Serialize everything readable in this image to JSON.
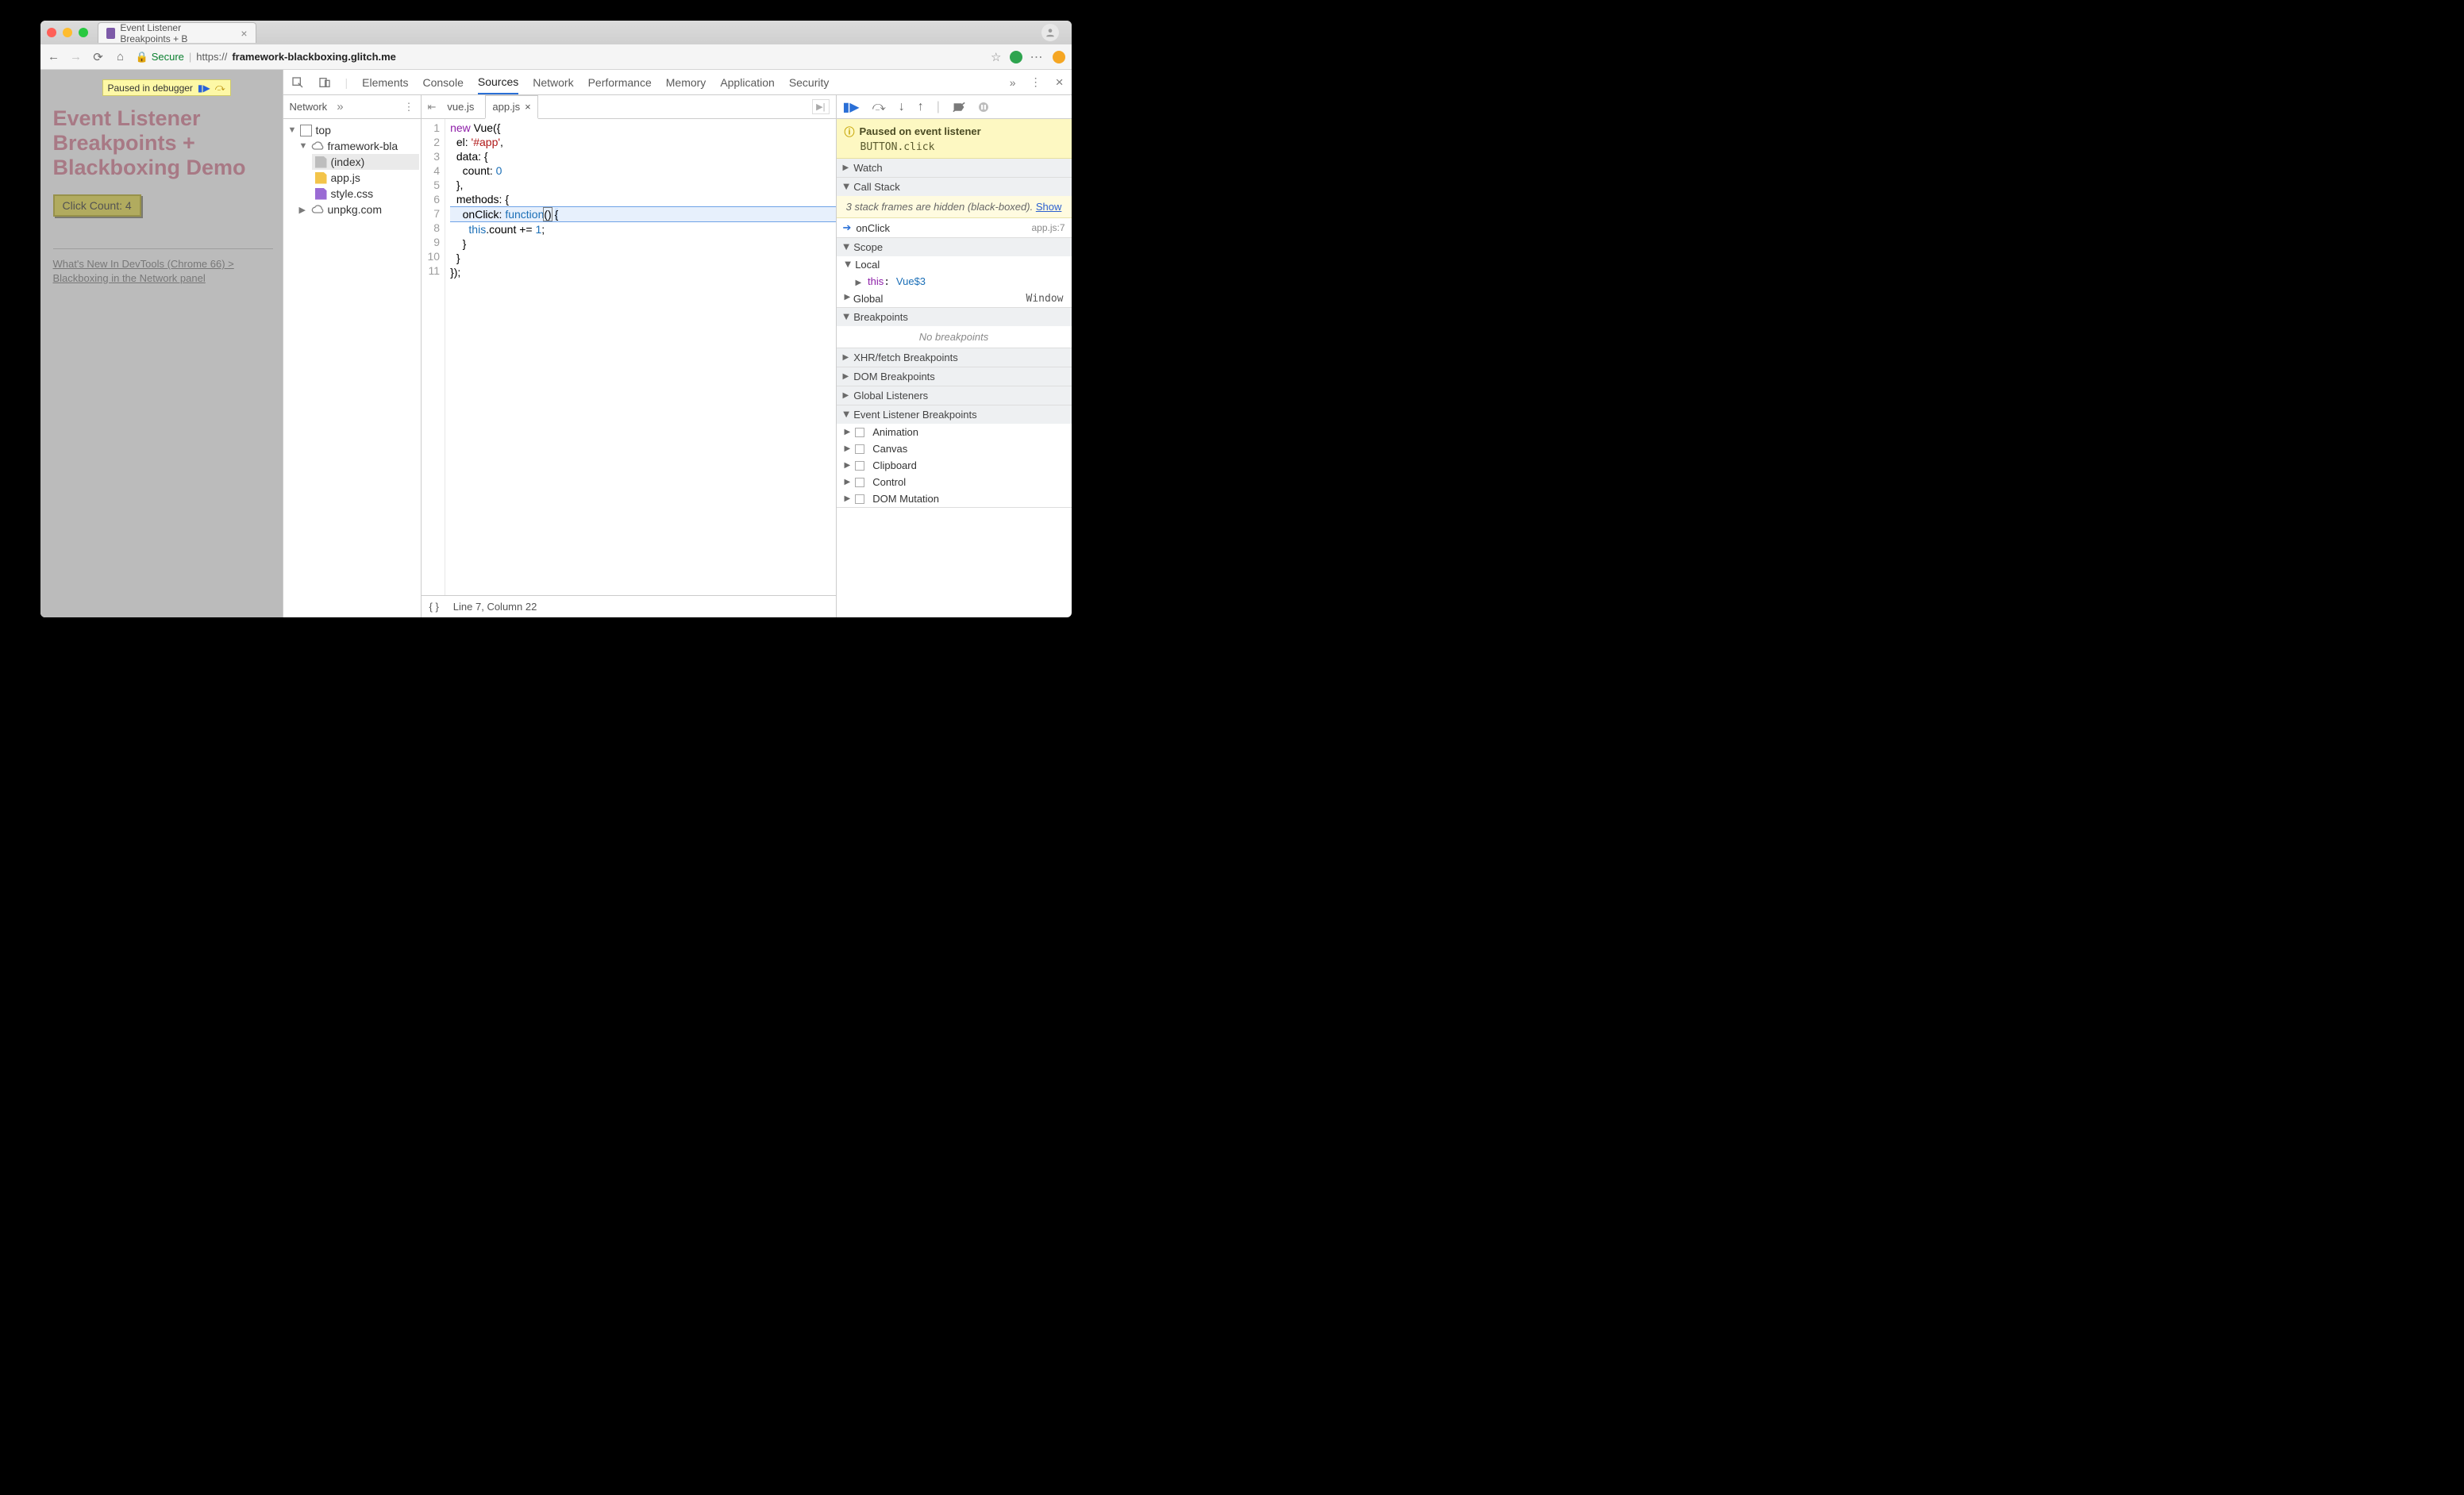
{
  "chrome": {
    "tab_title": "Event Listener Breakpoints + B",
    "secure_label": "Secure",
    "url_prefix": "https://",
    "url_host": "framework-blackboxing.glitch.me"
  },
  "page": {
    "pause_badge": "Paused in debugger",
    "heading": "Event Listener Breakpoints + Blackboxing Demo",
    "button_label": "Click Count: 4",
    "link_text": "What's New In DevTools (Chrome 66) > Blackboxing in the Network panel"
  },
  "devtools": {
    "tabs": [
      "Elements",
      "Console",
      "Sources",
      "Network",
      "Performance",
      "Memory",
      "Application",
      "Security"
    ],
    "active_tab": "Sources",
    "navigator": {
      "subtab": "Network",
      "tree": {
        "top": "top",
        "host": "framework-bla",
        "files": [
          "(index)",
          "app.js",
          "style.css"
        ],
        "external": "unpkg.com"
      }
    },
    "editor": {
      "open_tabs": [
        "vue.js",
        "app.js"
      ],
      "active_tab": "app.js",
      "lines": [
        "new Vue({",
        "  el: '#app',",
        "  data: {",
        "    count: 0",
        "  },",
        "  methods: {",
        "    onClick: function() {",
        "      this.count += 1;",
        "    }",
        "  }",
        "});"
      ],
      "status": "Line 7, Column 22"
    },
    "paused": {
      "title": "Paused on event listener",
      "detail": "BUTTON.click"
    },
    "sections": {
      "watch": "Watch",
      "callstack": "Call Stack",
      "stack_hidden_msg_a": "3 stack frames are hidden (black-boxed).",
      "stack_hidden_show": "Show",
      "stack_frame": "onClick",
      "stack_loc": "app.js:7",
      "scope": "Scope",
      "scope_local": "Local",
      "scope_this": "this",
      "scope_this_val": "Vue$3",
      "scope_global": "Global",
      "scope_global_val": "Window",
      "breakpoints": "Breakpoints",
      "no_breakpoints": "No breakpoints",
      "xhr": "XHR/fetch Breakpoints",
      "dom": "DOM Breakpoints",
      "global_listeners": "Global Listeners",
      "elb": "Event Listener Breakpoints",
      "elb_categories": [
        "Animation",
        "Canvas",
        "Clipboard",
        "Control",
        "DOM Mutation"
      ]
    }
  }
}
